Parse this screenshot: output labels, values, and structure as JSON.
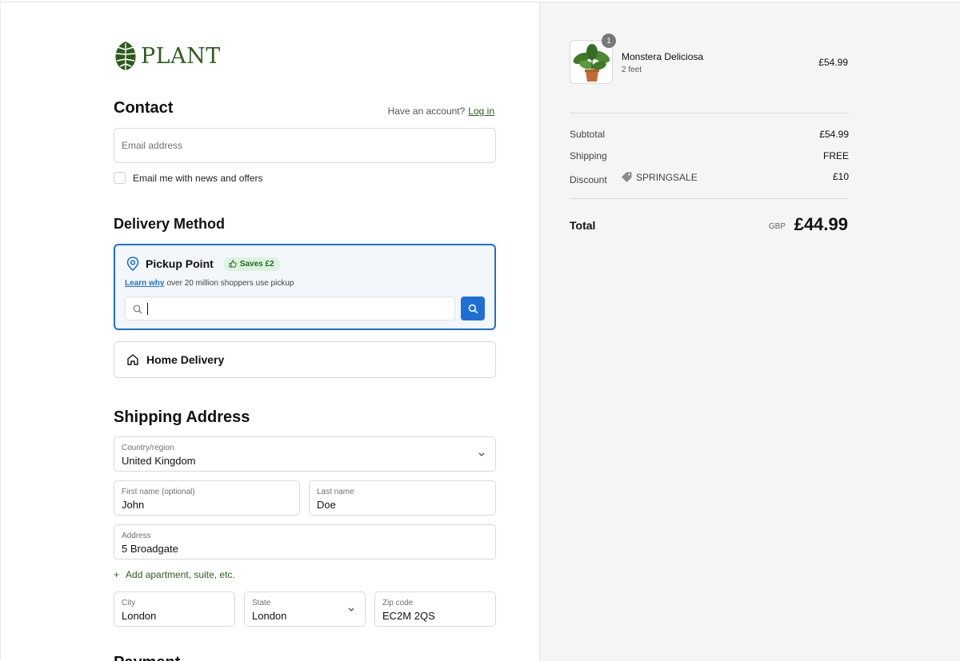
{
  "brand": {
    "name": "PLANT",
    "color": "#2f5a1f"
  },
  "contact": {
    "title": "Contact",
    "account_prompt": "Have an account?",
    "login_label": "Log in",
    "email_placeholder": "Email address",
    "newsletter_label": "Email me with news and offers"
  },
  "delivery": {
    "title": "Delivery Method",
    "pickup": {
      "title": "Pickup Point",
      "badge": "Saves £2",
      "learn_link": "Learn why",
      "subtitle": "over 20 million shoppers use pickup",
      "search_value": "",
      "selected": true
    },
    "home": {
      "title": "Home Delivery"
    }
  },
  "shipping": {
    "title": "Shipping Address",
    "country": {
      "label": "Country/region",
      "value": "United Kingdom"
    },
    "first_name": {
      "label": "First name (optional)",
      "value": "John"
    },
    "last_name": {
      "label": "Last name",
      "value": "Doe"
    },
    "address": {
      "label": "Address",
      "value": "5 Broadgate"
    },
    "add_apartment": "Add apartment, suite, etc.",
    "city": {
      "label": "City",
      "value": "London"
    },
    "state": {
      "label": "State",
      "value": "London"
    },
    "zip": {
      "label": "Zip code",
      "value": "EC2M 2QS"
    }
  },
  "payment": {
    "title": "Payment"
  },
  "order": {
    "item": {
      "name": "Monstera Deliciosa",
      "variant": "2 feet",
      "price": "£54.99",
      "quantity": "1"
    },
    "subtotal": {
      "label": "Subtotal",
      "value": "£54.99"
    },
    "shipping": {
      "label": "Shipping",
      "value": "FREE"
    },
    "discount": {
      "label": "Discount",
      "code": "SPRINGSALE",
      "value": "£10"
    },
    "total": {
      "label": "Total",
      "currency": "GBP",
      "value": "£44.99"
    }
  },
  "colors": {
    "accent_blue": "#1d6fd6",
    "badge_green_bg": "#dcf3dd",
    "summary_bg": "#f5f5f5"
  }
}
